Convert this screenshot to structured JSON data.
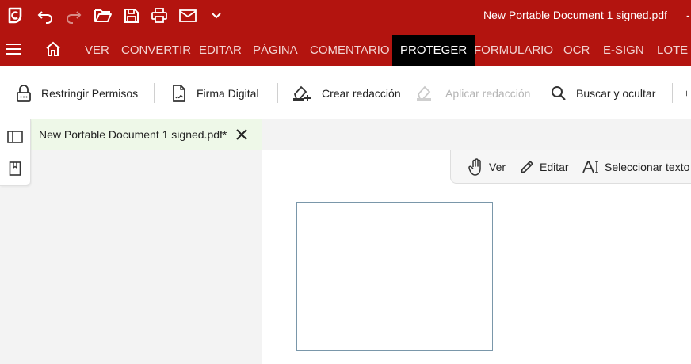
{
  "window": {
    "title": "New Portable Document 1 signed.pdf",
    "title_extra": "-"
  },
  "quick_access": {
    "icons": [
      "app-logo-icon",
      "undo-icon",
      "redo-icon",
      "open-folder-icon",
      "save-icon",
      "print-icon",
      "mail-icon",
      "chevron-down-icon"
    ]
  },
  "ribbon": {
    "tabs": [
      {
        "label": "VER"
      },
      {
        "label": "CONVERTIR"
      },
      {
        "label": "EDITAR"
      },
      {
        "label": "PÁGINA"
      },
      {
        "label": "COMENTARIO"
      },
      {
        "label": "PROTEGER",
        "active": true
      },
      {
        "label": "FORMULARIO"
      },
      {
        "label": "OCR"
      },
      {
        "label": "E-SIGN"
      },
      {
        "label": "LOTE"
      }
    ]
  },
  "toolbar": {
    "items": [
      {
        "label": "Restringir Permisos",
        "icon": "lock-icon"
      },
      {
        "label": "Firma Digital",
        "icon": "digital-signature-icon"
      },
      {
        "label": "Crear redacción",
        "icon": "create-redaction-icon"
      },
      {
        "label": "Aplicar redacción",
        "icon": "apply-redaction-icon",
        "disabled": true
      },
      {
        "label": "Buscar y ocultar",
        "icon": "search-icon"
      }
    ]
  },
  "document_tab": {
    "label": "New Portable Document 1 signed.pdf*"
  },
  "side_rail": {
    "icons": [
      "panel-toggle-icon",
      "bookmark-icon"
    ]
  },
  "view_tools": {
    "items": [
      {
        "label": "Ver",
        "icon": "hand-icon"
      },
      {
        "label": "Editar",
        "icon": "pencil-icon"
      },
      {
        "label": "Seleccionar texto",
        "icon": "select-text-icon"
      }
    ]
  },
  "colors": {
    "brand": "#b3140f",
    "active_tab": "#000000",
    "document_tab_bg": "#eef8e8"
  }
}
